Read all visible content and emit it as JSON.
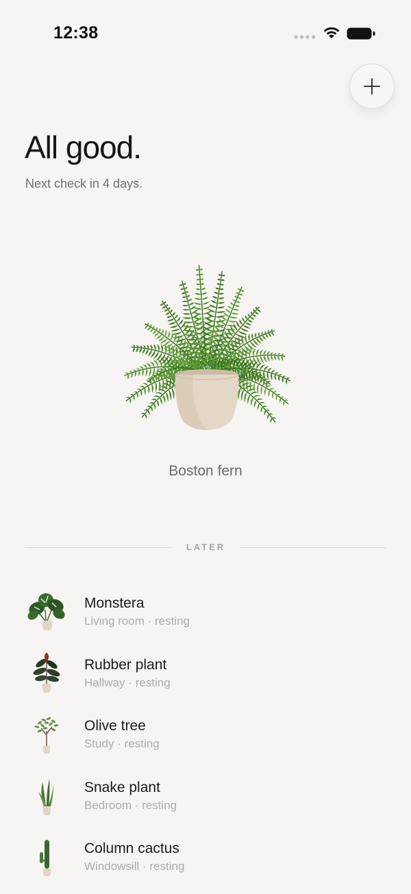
{
  "status_bar": {
    "time": "12:38",
    "icons": [
      "signal-icon",
      "wifi-icon",
      "battery-icon"
    ]
  },
  "header": {
    "add_button_icon": "plus-icon"
  },
  "summary": {
    "title": "All good.",
    "subtitle": "Next check in 4 days."
  },
  "featured": {
    "name": "Boston fern",
    "icon": "fern-icon"
  },
  "section": {
    "label": "LATER"
  },
  "plants": [
    {
      "name": "Monstera",
      "meta": "Living room · resting",
      "icon": "monstera-icon"
    },
    {
      "name": "Rubber plant",
      "meta": "Hallway · resting",
      "icon": "rubber-plant-icon"
    },
    {
      "name": "Olive tree",
      "meta": "Study · resting",
      "icon": "olive-tree-icon"
    },
    {
      "name": "Snake plant",
      "meta": "Bedroom · resting",
      "icon": "snake-plant-icon"
    },
    {
      "name": "Column cactus",
      "meta": "Windowsill · resting",
      "icon": "cactus-icon"
    }
  ],
  "colors": {
    "background": "#f6f5f3",
    "title": "#161616",
    "muted_text": "#707070",
    "meta_text": "#aeacaa",
    "leaf_green": "#3f7d22",
    "pot": "#e3d6c4"
  }
}
